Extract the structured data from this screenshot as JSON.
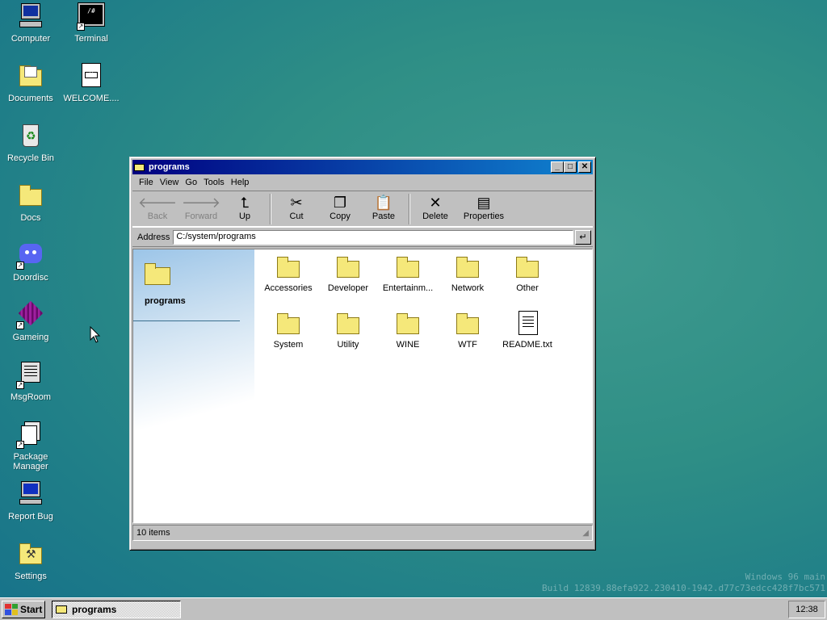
{
  "desktop": {
    "icons": [
      {
        "label": "Computer",
        "icon": "computer-icon"
      },
      {
        "label": "Terminal",
        "icon": "terminal-icon"
      },
      {
        "label": "Documents",
        "icon": "documents-folder-icon"
      },
      {
        "label": "WELCOME....",
        "icon": "markdown-file-icon"
      },
      {
        "label": "Recycle Bin",
        "icon": "recycle-bin-icon"
      },
      {
        "label": "Docs",
        "icon": "folder-icon"
      },
      {
        "label": "Doordisc",
        "icon": "doordisc-icon"
      },
      {
        "label": "Gameing",
        "icon": "cube-icon"
      },
      {
        "label": "MsgRoom",
        "icon": "chat-icon"
      },
      {
        "label": "Package Manager",
        "icon": "package-icon"
      },
      {
        "label": "Report Bug",
        "icon": "monitor-bug-icon"
      },
      {
        "label": "Settings",
        "icon": "settings-icon"
      }
    ]
  },
  "window": {
    "title": "programs",
    "menu": [
      "File",
      "View",
      "Go",
      "Tools",
      "Help"
    ],
    "toolbar": {
      "back": "Back",
      "forward": "Forward",
      "up": "Up",
      "cut": "Cut",
      "copy": "Copy",
      "paste": "Paste",
      "delete": "Delete",
      "properties": "Properties"
    },
    "address": {
      "label": "Address",
      "value": "C:/system/programs"
    },
    "sidebar_heading": "programs",
    "files": [
      {
        "name": "Accessories",
        "type": "folder"
      },
      {
        "name": "Developer",
        "type": "folder"
      },
      {
        "name": "Entertainm...",
        "type": "folder"
      },
      {
        "name": "Network",
        "type": "folder"
      },
      {
        "name": "Other",
        "type": "folder"
      },
      {
        "name": "System",
        "type": "folder"
      },
      {
        "name": "Utility",
        "type": "folder"
      },
      {
        "name": "WINE",
        "type": "folder"
      },
      {
        "name": "WTF",
        "type": "folder"
      },
      {
        "name": "README.txt",
        "type": "text-file"
      }
    ],
    "status": "10 items"
  },
  "watermark": {
    "line1": "Windows 96 main",
    "line2": "Build 12839.88efa922.230410-1942.d77c73edcc428f7bc571"
  },
  "taskbar": {
    "start": "Start",
    "task": "programs",
    "clock": "12:38"
  }
}
